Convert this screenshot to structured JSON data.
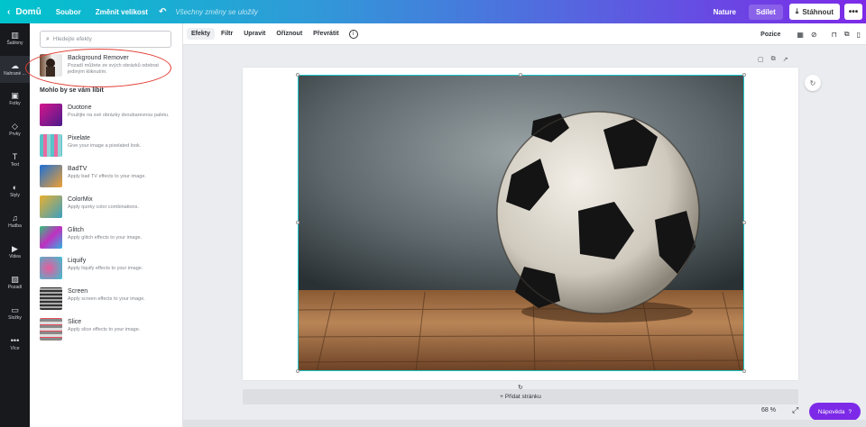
{
  "topbar": {
    "home": "Domů",
    "file": "Soubor",
    "resize": "Změnit velikost",
    "saved": "Všechny změny se uložily",
    "design_name": "Nature",
    "share": "Sdílet",
    "download": "Stáhnout",
    "more": "•••"
  },
  "nav": [
    {
      "label": "Šablony",
      "icon": "templates-icon"
    },
    {
      "label": "Nahrané ...",
      "icon": "upload-icon"
    },
    {
      "label": "Fotky",
      "icon": "photos-icon"
    },
    {
      "label": "Prvky",
      "icon": "elements-icon"
    },
    {
      "label": "Text",
      "icon": "text-icon"
    },
    {
      "label": "Styly",
      "icon": "styles-icon"
    },
    {
      "label": "Hudba",
      "icon": "music-icon"
    },
    {
      "label": "Videa",
      "icon": "video-icon"
    },
    {
      "label": "Pozadí",
      "icon": "background-icon"
    },
    {
      "label": "Složky",
      "icon": "folder-icon"
    },
    {
      "label": "Více",
      "icon": "more-icon"
    }
  ],
  "panel": {
    "search_placeholder": "Hledejte efekty",
    "featured": {
      "title": "Background Remover",
      "desc": "Pozadí můžete ze svých obrázků odebrat jediným kliknutím."
    },
    "section_title": "Mohlo by se vám líbit",
    "effects": [
      {
        "title": "Duotone",
        "desc": "Použijte na své obrázky dvoubarevnou paletu."
      },
      {
        "title": "Pixelate",
        "desc": "Give your image a pixelated look."
      },
      {
        "title": "BadTV",
        "desc": "Apply bad TV effects to your image."
      },
      {
        "title": "ColorMix",
        "desc": "Apply quirky color combinations."
      },
      {
        "title": "Glitch",
        "desc": "Apply glitch effects to your image."
      },
      {
        "title": "Liquify",
        "desc": "Apply liquify effects to your image."
      },
      {
        "title": "Screen",
        "desc": "Apply screen effects to your image."
      },
      {
        "title": "Slice",
        "desc": "Apply slice effects to your image."
      }
    ]
  },
  "toolbar": {
    "effects": "Efekty",
    "filter": "Filtr",
    "adjust": "Upravit",
    "crop": "Oříznout",
    "flip": "Převrátit",
    "info": "i",
    "position": "Pozice"
  },
  "canvas": {
    "add_page": "+ Přidat stránku",
    "zoom": "68 %",
    "help": "Nápověda",
    "help_icon": "?"
  },
  "colors": {
    "accent": "#7d2ae8",
    "selection": "#1fc6c9"
  }
}
